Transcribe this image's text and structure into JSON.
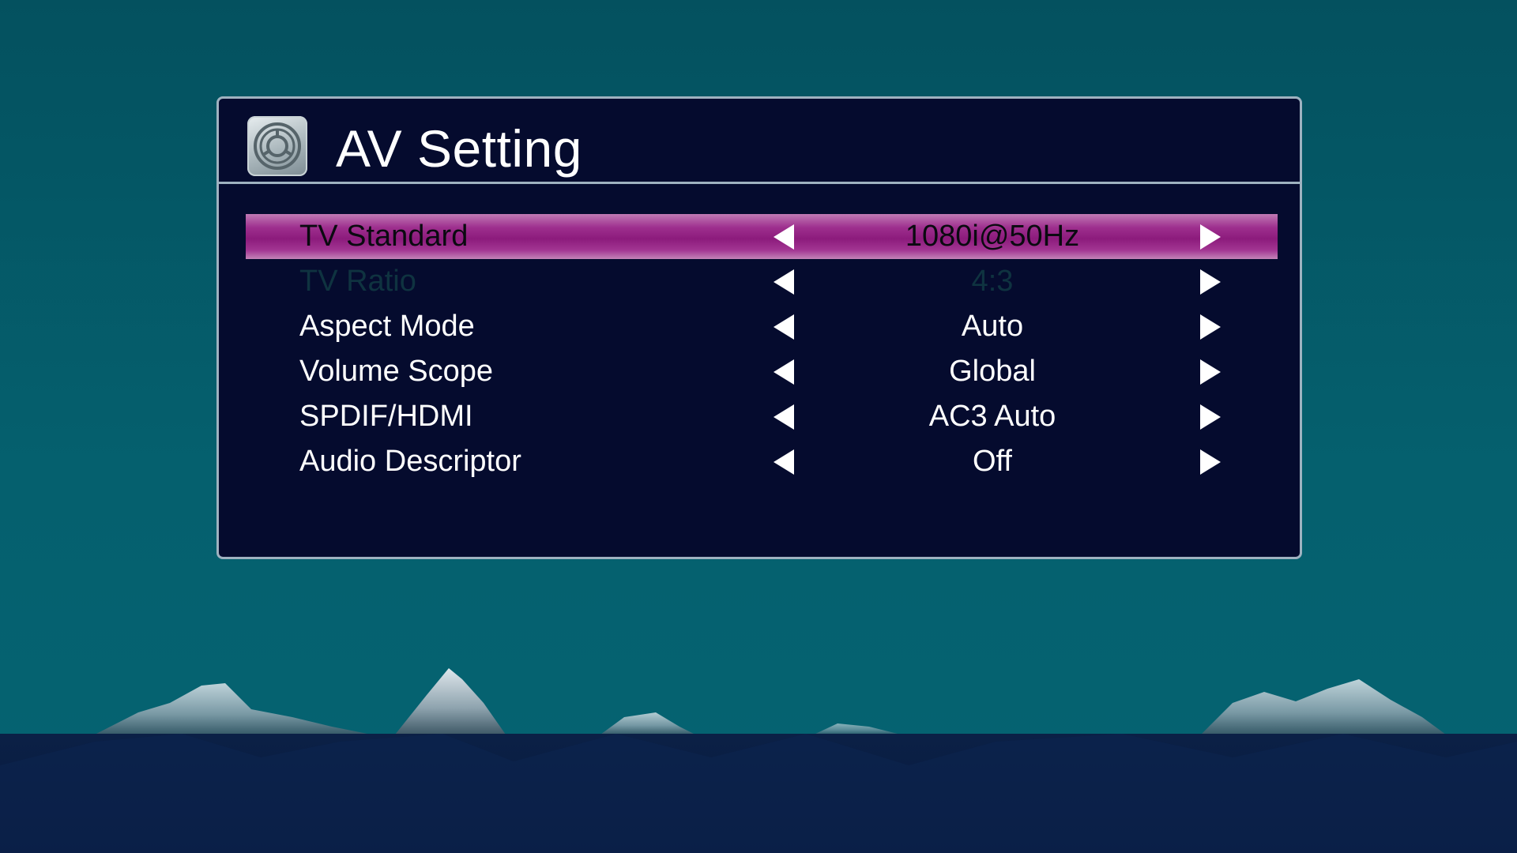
{
  "screen": {
    "title": "AV Setting",
    "icon": "settings-gear-icon"
  },
  "colors": {
    "background": "#05606e",
    "panel": "#050b2e",
    "panel_border": "#9fb2c0",
    "highlight": "#8c1b7c",
    "disabled_text": "#0f3340"
  },
  "menu": {
    "items": [
      {
        "label": "TV Standard",
        "value": "1080i@50Hz",
        "state": "selected"
      },
      {
        "label": "TV Ratio",
        "value": "4:3",
        "state": "disabled"
      },
      {
        "label": "Aspect Mode",
        "value": "Auto",
        "state": "normal"
      },
      {
        "label": "Volume Scope",
        "value": "Global",
        "state": "normal"
      },
      {
        "label": "SPDIF/HDMI",
        "value": "AC3 Auto",
        "state": "normal"
      },
      {
        "label": "Audio Descriptor",
        "value": "Off",
        "state": "normal"
      }
    ]
  }
}
